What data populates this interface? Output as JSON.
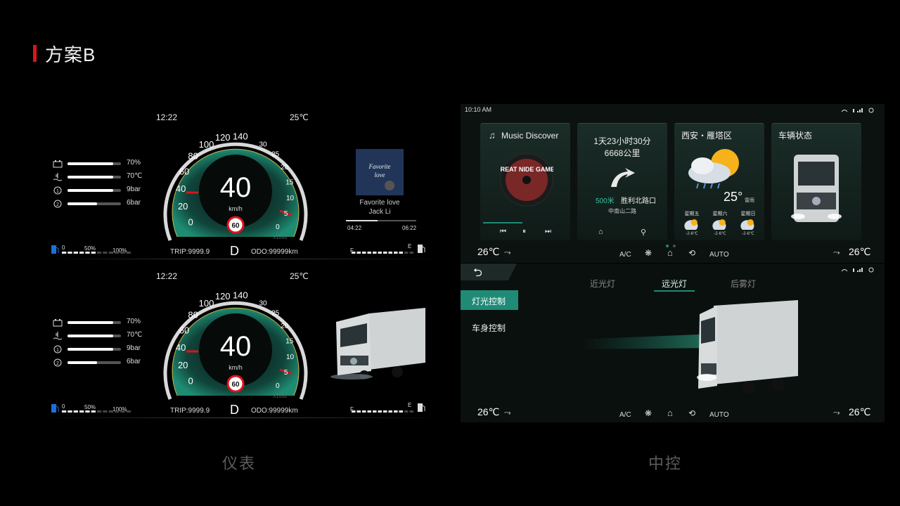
{
  "header": {
    "title": "方案B"
  },
  "sections": {
    "cluster": "仪表",
    "console": "中控"
  },
  "colors": {
    "accent": "#e0121b",
    "teal": "#1f8a75",
    "card": "#1b2d28"
  },
  "clusters": [
    {
      "time": "12:22",
      "temp": "25℃",
      "speed": "40",
      "unit": "km/h",
      "limit": "60",
      "bars": [
        {
          "icon": "battery-icon",
          "value": "70%",
          "level": 0.85
        },
        {
          "icon": "coolant-temp-icon",
          "value": "70℃",
          "level": 0.85
        },
        {
          "icon": "tire-pressure-1-icon",
          "value": "9bar",
          "level": 0.85
        },
        {
          "icon": "tire-pressure-2-icon",
          "value": "6bar",
          "level": 0.55
        }
      ],
      "trip": "TRIP:9999.9",
      "gear": "D",
      "odo": "ODO:99999km",
      "fuel": {
        "zero": "0",
        "half": "50%",
        "full": "100%",
        "f": "F",
        "e": "E"
      },
      "media": {
        "track": "Favorite love",
        "artist": "Jack Li",
        "elapsed": "04:22",
        "total": "06:22",
        "progress": 0.45
      }
    },
    {
      "time": "12:22",
      "temp": "25℃",
      "speed": "40",
      "unit": "km/h",
      "limit": "60",
      "bars": [
        {
          "icon": "battery-icon",
          "value": "70%",
          "level": 0.85
        },
        {
          "icon": "coolant-temp-icon",
          "value": "70℃",
          "level": 0.85
        },
        {
          "icon": "tire-pressure-1-icon",
          "value": "9bar",
          "level": 0.85
        },
        {
          "icon": "tire-pressure-2-icon",
          "value": "6bar",
          "level": 0.55
        }
      ],
      "trip": "TRIP:9999.9",
      "gear": "D",
      "odo": "ODO:99999km",
      "fuel": {
        "zero": "0",
        "half": "50%",
        "full": "100%",
        "f": "F",
        "e": "E"
      }
    }
  ],
  "gauge": {
    "ticks": [
      "0",
      "20",
      "40",
      "60",
      "80",
      "100",
      "120",
      "140"
    ],
    "rpm": [
      "0",
      "5",
      "10",
      "15",
      "20",
      "25",
      "30"
    ],
    "rpm_unit": "X1000"
  },
  "console_top": {
    "time": "10:10 AM",
    "music": {
      "title": "Music Discover",
      "album_text": "GREAT NIDE GAME MU"
    },
    "nav": {
      "eta": "1天23小时30分",
      "distance": "6668公里",
      "next": "500米",
      "road": "胜利北路口",
      "sub": "中南山二路"
    },
    "weather": {
      "title": "西安・雁塔区",
      "temp": "25°",
      "cond": "雷雨",
      "days": [
        {
          "d": "星期五",
          "t": "-2-6℃"
        },
        {
          "d": "星期六",
          "t": "-2-6℃"
        },
        {
          "d": "星期日",
          "t": "-2-6℃"
        }
      ]
    },
    "vehicle": {
      "title": "车辆状态"
    },
    "climate": {
      "left": "26℃",
      "right": "26℃",
      "ac": "A/C",
      "auto": "AUTO"
    }
  },
  "console_bottom": {
    "tabs": [
      "近光灯",
      "远光灯",
      "后雾灯"
    ],
    "active_tab": 1,
    "menu": [
      "灯光控制",
      "车身控制"
    ],
    "active_menu": 0,
    "climate": {
      "left": "26℃",
      "right": "26℃",
      "ac": "A/C",
      "auto": "AUTO"
    }
  }
}
